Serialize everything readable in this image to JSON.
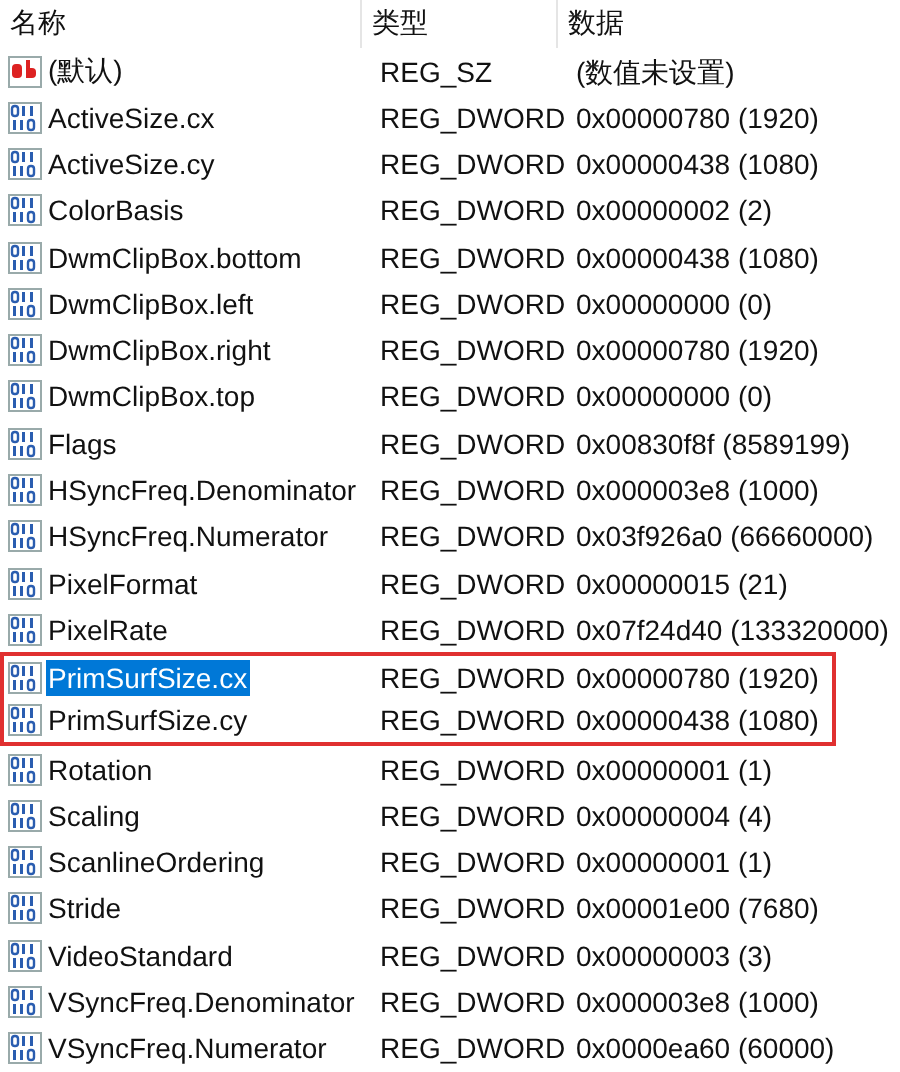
{
  "columns": [
    "名称",
    "类型",
    "数据"
  ],
  "rows": [
    {
      "kind": "string",
      "name": "(默认)",
      "type": "REG_SZ",
      "data": "(数值未设置)",
      "selected": false,
      "highlighted": false
    },
    {
      "kind": "binary",
      "name": "ActiveSize.cx",
      "type": "REG_DWORD",
      "data": "0x00000780 (1920)",
      "selected": false,
      "highlighted": false
    },
    {
      "kind": "binary",
      "name": "ActiveSize.cy",
      "type": "REG_DWORD",
      "data": "0x00000438 (1080)",
      "selected": false,
      "highlighted": false
    },
    {
      "kind": "binary",
      "name": "ColorBasis",
      "type": "REG_DWORD",
      "data": "0x00000002 (2)",
      "selected": false,
      "highlighted": false
    },
    {
      "kind": "binary",
      "name": "DwmClipBox.bottom",
      "type": "REG_DWORD",
      "data": "0x00000438 (1080)",
      "selected": false,
      "highlighted": false
    },
    {
      "kind": "binary",
      "name": "DwmClipBox.left",
      "type": "REG_DWORD",
      "data": "0x00000000 (0)",
      "selected": false,
      "highlighted": false
    },
    {
      "kind": "binary",
      "name": "DwmClipBox.right",
      "type": "REG_DWORD",
      "data": "0x00000780 (1920)",
      "selected": false,
      "highlighted": false
    },
    {
      "kind": "binary",
      "name": "DwmClipBox.top",
      "type": "REG_DWORD",
      "data": "0x00000000 (0)",
      "selected": false,
      "highlighted": false
    },
    {
      "kind": "binary",
      "name": "Flags",
      "type": "REG_DWORD",
      "data": "0x00830f8f (8589199)",
      "selected": false,
      "highlighted": false
    },
    {
      "kind": "binary",
      "name": "HSyncFreq.Denominator",
      "type": "REG_DWORD",
      "data": "0x000003e8 (1000)",
      "selected": false,
      "highlighted": false
    },
    {
      "kind": "binary",
      "name": "HSyncFreq.Numerator",
      "type": "REG_DWORD",
      "data": "0x03f926a0 (66660000)",
      "selected": false,
      "highlighted": false
    },
    {
      "kind": "binary",
      "name": "PixelFormat",
      "type": "REG_DWORD",
      "data": "0x00000015 (21)",
      "selected": false,
      "highlighted": false
    },
    {
      "kind": "binary",
      "name": "PixelRate",
      "type": "REG_DWORD",
      "data": "0x07f24d40 (133320000)",
      "selected": false,
      "highlighted": false
    },
    {
      "kind": "binary",
      "name": "PrimSurfSize.cx",
      "type": "REG_DWORD",
      "data": "0x00000780 (1920)",
      "selected": true,
      "highlighted": true
    },
    {
      "kind": "binary",
      "name": "PrimSurfSize.cy",
      "type": "REG_DWORD",
      "data": "0x00000438 (1080)",
      "selected": false,
      "highlighted": true
    },
    {
      "kind": "binary",
      "name": "Rotation",
      "type": "REG_DWORD",
      "data": "0x00000001 (1)",
      "selected": false,
      "highlighted": false
    },
    {
      "kind": "binary",
      "name": "Scaling",
      "type": "REG_DWORD",
      "data": "0x00000004 (4)",
      "selected": false,
      "highlighted": false
    },
    {
      "kind": "binary",
      "name": "ScanlineOrdering",
      "type": "REG_DWORD",
      "data": "0x00000001 (1)",
      "selected": false,
      "highlighted": false
    },
    {
      "kind": "binary",
      "name": "Stride",
      "type": "REG_DWORD",
      "data": "0x00001e00 (7680)",
      "selected": false,
      "highlighted": false
    },
    {
      "kind": "binary",
      "name": "VideoStandard",
      "type": "REG_DWORD",
      "data": "0x00000003 (3)",
      "selected": false,
      "highlighted": false
    },
    {
      "kind": "binary",
      "name": "VSyncFreq.Denominator",
      "type": "REG_DWORD",
      "data": "0x000003e8 (1000)",
      "selected": false,
      "highlighted": false
    },
    {
      "kind": "binary",
      "name": "VSyncFreq.Numerator",
      "type": "REG_DWORD",
      "data": "0x0000ea60 (60000)",
      "selected": false,
      "highlighted": false
    }
  ]
}
